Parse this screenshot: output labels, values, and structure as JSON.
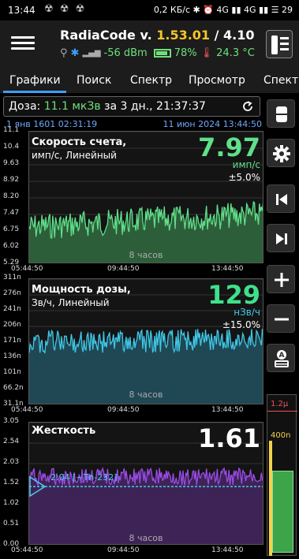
{
  "status": {
    "time": "13:44",
    "right_text": "0,2 КБ/с ✱ ⏰ 4G ▮▮ 4G ▮▮ ☰ 29"
  },
  "app": {
    "title_prefix": "RadiaCode v. ",
    "version": "1.53.01",
    "title_suffix": " / 4.10",
    "signal": "-56 dBm",
    "battery": "78%",
    "temperature": "24.3 °C"
  },
  "tabs": [
    "Графики",
    "Поиск",
    "Спектр",
    "Просмотр",
    "Спектр"
  ],
  "dose": {
    "label": "Доза: ",
    "value": "11.1 мкЗв",
    "period": " за 3 дн., 21:37:37"
  },
  "dates": {
    "left": "1 янв 1601 02:31:19",
    "right": "11 июн 2024 13:44:50"
  },
  "panels": [
    {
      "title": "Скорость счета,",
      "subtitle": "имп/с, Линейный",
      "value": "7.97",
      "unit": "имп/с",
      "error": "±5.0%",
      "span": "8 часов",
      "color": "#5fe08a",
      "fill": "#2d5e3a",
      "yticks": [
        "11.1",
        "10.4",
        "9.63",
        "8.92",
        "8.20",
        "7.47",
        "6.75",
        "6.02",
        "5.29"
      ],
      "xticks": [
        "05:44:50",
        "09:44:50",
        "13:44:50"
      ]
    },
    {
      "title": "Мощность дозы,",
      "subtitle": "Зв/ч, Линейный",
      "value": "129",
      "unit": "нЗв/ч",
      "error": "±15.0%",
      "span": "8 часов",
      "color": "#3fc8e8",
      "fill": "#1f4854",
      "yticks": [
        "311n",
        "276n",
        "241n",
        "206n",
        "171n",
        "136n",
        "101n",
        "66.2n",
        "31.1n"
      ],
      "xticks": [
        "05:44:50",
        "09:44:50",
        "13:44:50"
      ]
    },
    {
      "title": "Жесткость",
      "subtitle": "",
      "value": "1.61",
      "unit": "",
      "error": "",
      "span": "8 часов",
      "color": "#9b4be8",
      "fill": "#3e2456",
      "marker": "2.04 [~Th-232]",
      "yticks": [
        "3.05",
        "2.54",
        "2.03",
        "1.52",
        "1.02",
        "0.51",
        "0.00"
      ],
      "xticks": [
        "05:44:50",
        "09:44:50",
        "13:44:50"
      ]
    }
  ],
  "level": {
    "label_top": "1.2μ",
    "label_mid": "400n"
  }
}
